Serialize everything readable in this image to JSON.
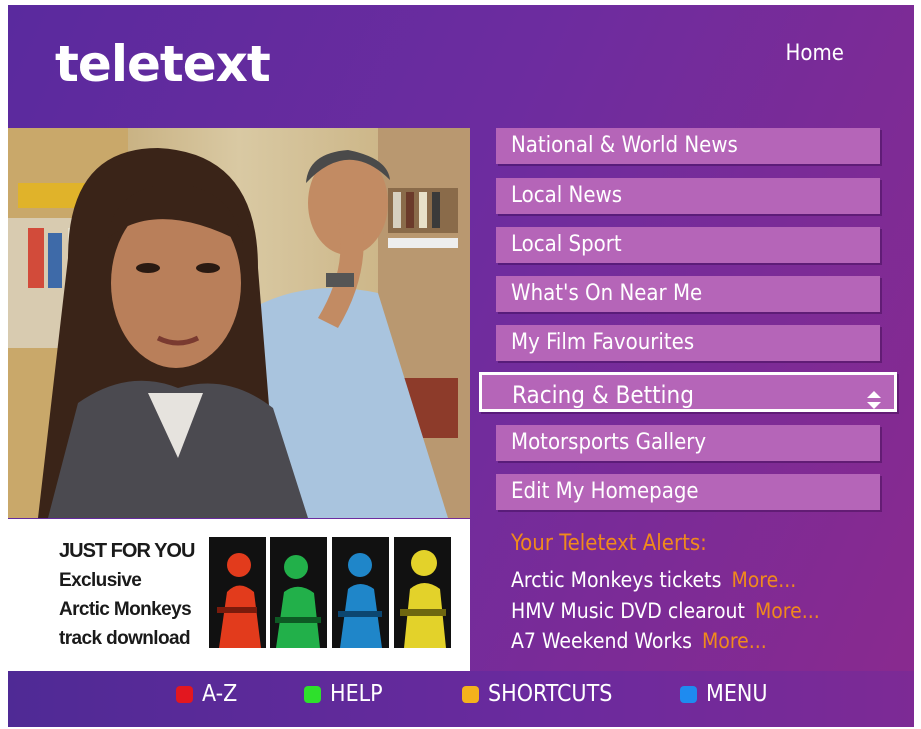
{
  "header": {
    "logo_text": "teletext",
    "home_label": "Home"
  },
  "nav": {
    "items": [
      {
        "label": "National & World News"
      },
      {
        "label": "Local News"
      },
      {
        "label": "Local Sport"
      },
      {
        "label": "What's On Near Me"
      },
      {
        "label": "My Film Favourites"
      },
      {
        "label": "Racing & Betting",
        "selected": true
      },
      {
        "label": "Motorsports Gallery"
      },
      {
        "label": "Edit My Homepage"
      }
    ]
  },
  "promo": {
    "line1": "JUST FOR YOU",
    "line2": "Exclusive",
    "line3": "Arctic Monkeys",
    "line4": "track download",
    "thumb_colors": [
      "#e23b1c",
      "#22b04a",
      "#1f86c9",
      "#e3d22a"
    ]
  },
  "alerts": {
    "title": "Your Teletext Alerts:",
    "items": [
      {
        "text": "Arctic Monkeys tickets",
        "more": "More..."
      },
      {
        "text": "HMV Music DVD clearout",
        "more": "More..."
      },
      {
        "text": "A7 Weekend Works",
        "more": "More..."
      }
    ]
  },
  "keys": {
    "red": {
      "label": "A-Z",
      "color": "#e3171f"
    },
    "green": {
      "label": "HELP",
      "color": "#2ee02c"
    },
    "yellow": {
      "label": "SHORTCUTS",
      "color": "#f4b21c"
    },
    "blue": {
      "label": "MENU",
      "color": "#1e8bf0"
    }
  },
  "colors": {
    "accent_orange": "#f08a1c",
    "button_fill": "#b565b8"
  }
}
